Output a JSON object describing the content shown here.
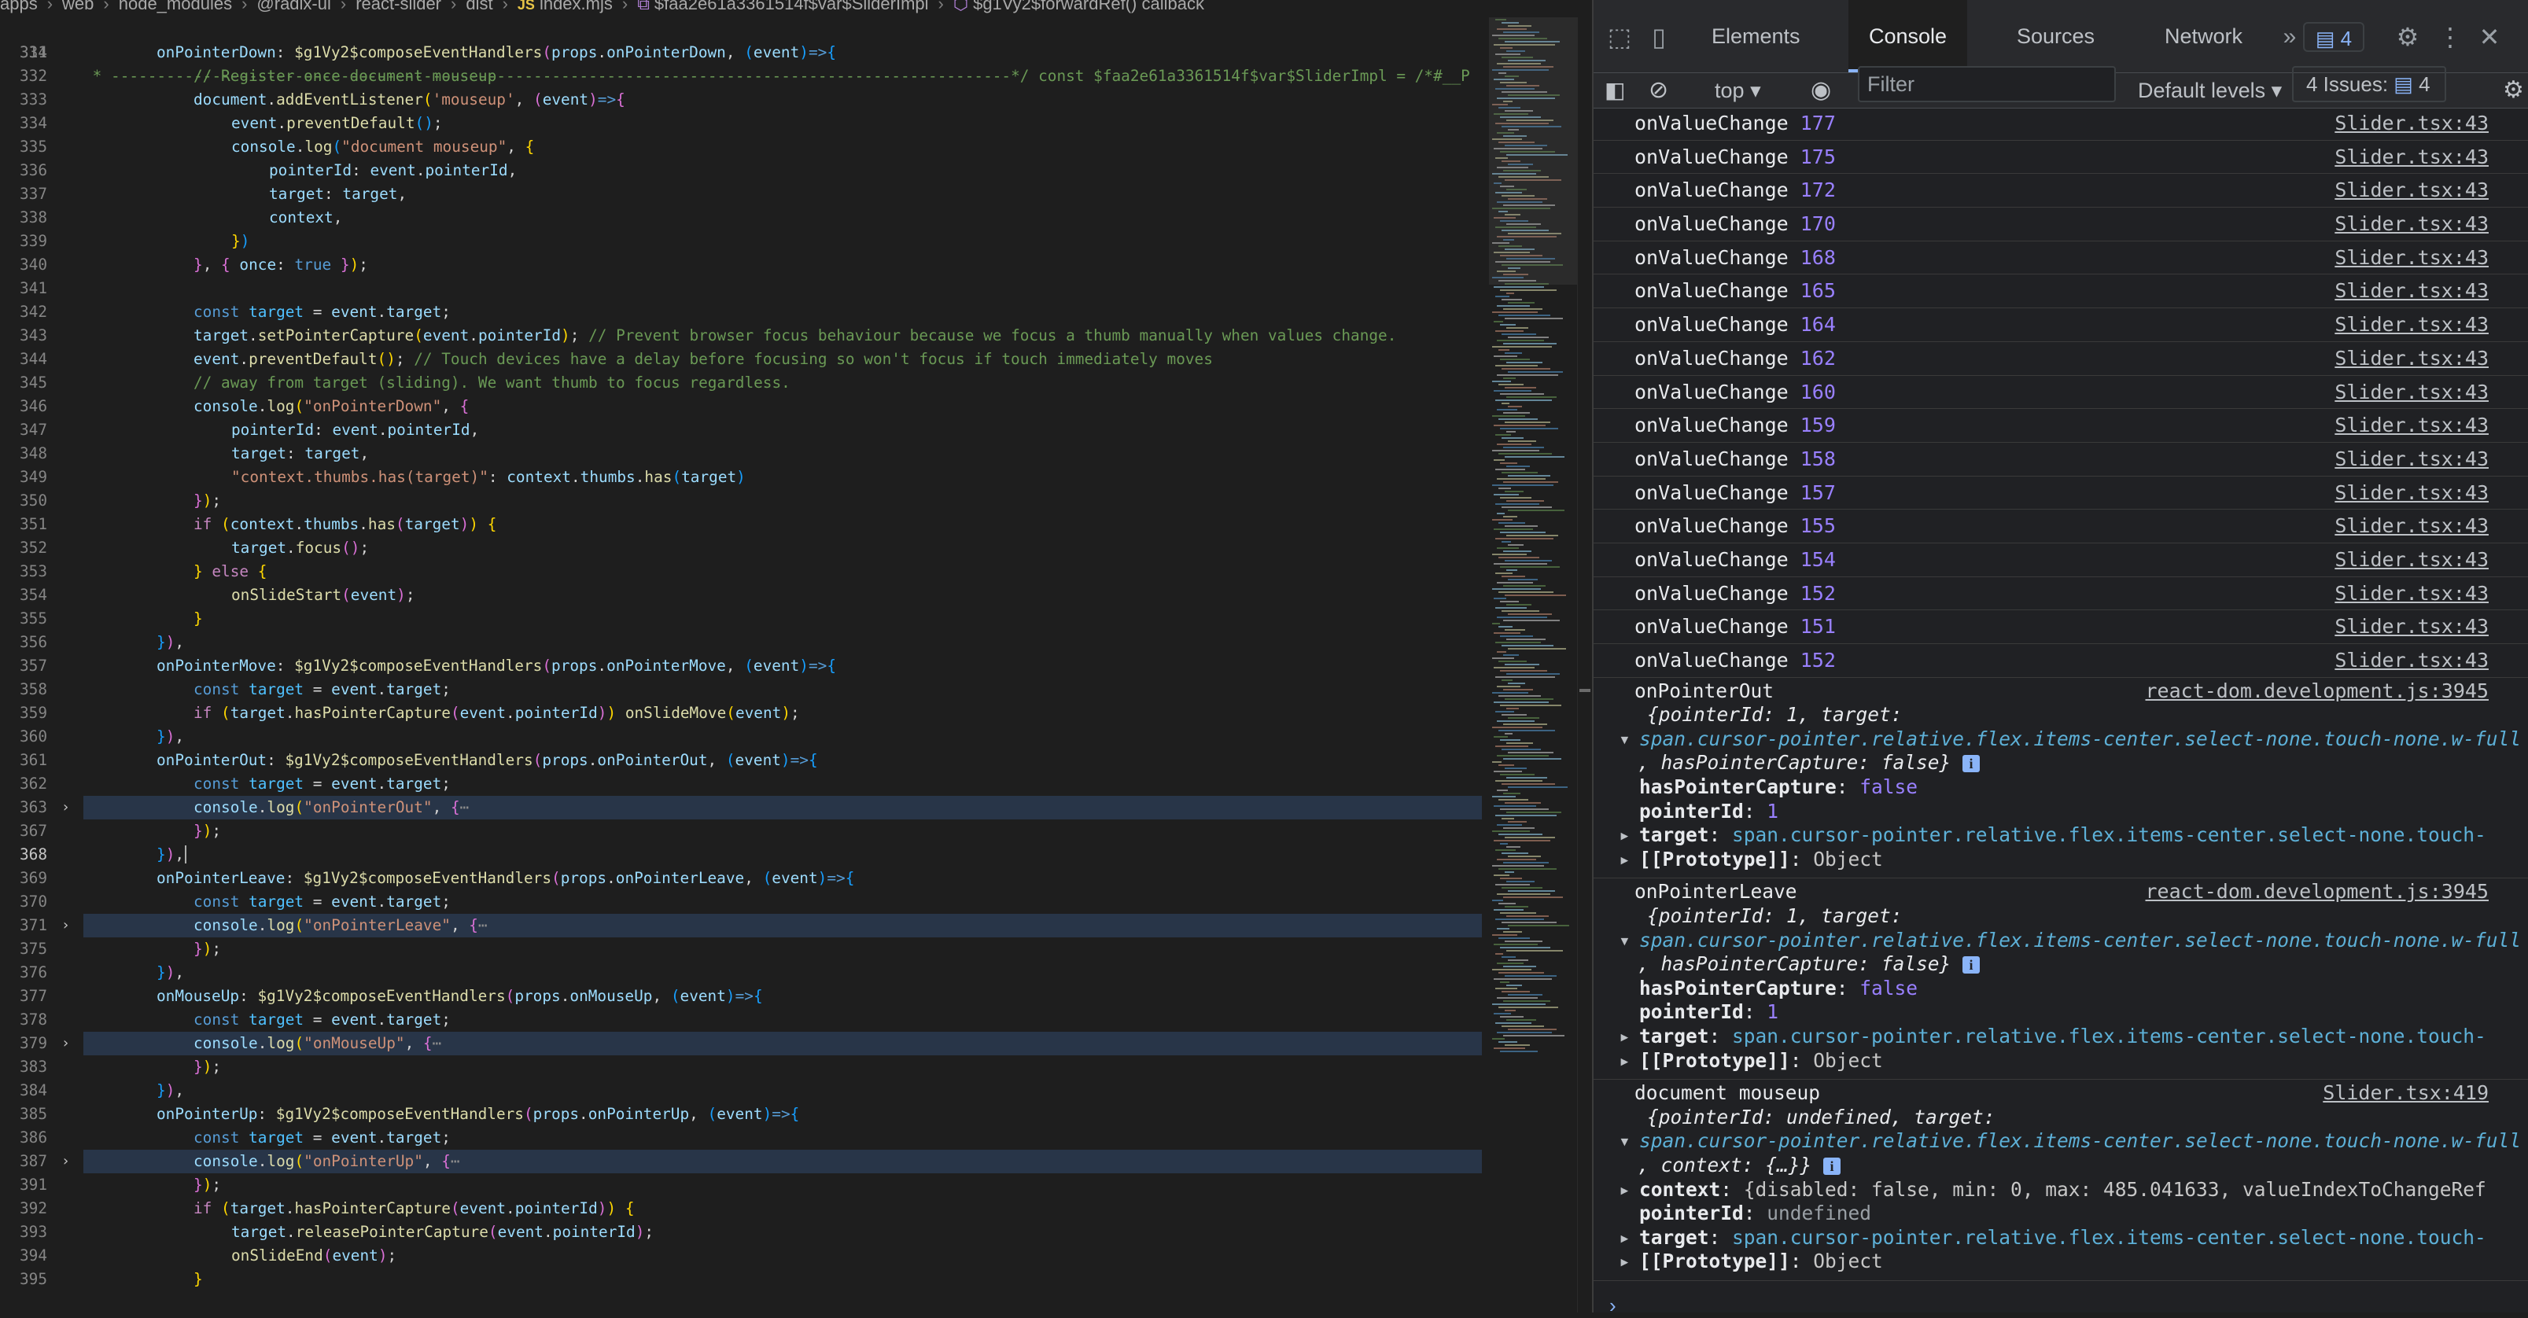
{
  "editor": {
    "breadcrumb": [
      "apps",
      "web",
      "node_modules",
      "@radix-ui",
      "react-slider",
      "dist",
      "index.mjs",
      "$faa2e61a3361514f$var$SliderImpl",
      "$g1Vy2$forwardRef() callback"
    ],
    "breadcrumb_js_icon": "JS",
    "sticky_line_number": "314",
    "sticky_line_text": " * --------------------------------------------------------------------------------------------------*/ const $faa2e61a3361514f$var$SliderImpl = /*#__P",
    "lines": [
      {
        "n": "331",
        "html": "<span class=\"i1\"></span><span class=\"v\">onPointerDown</span>: <span class=\"fn\">$g1Vy2$composeEventHandlers</span><span class=\"b2\">(</span><span class=\"v\">props</span>.<span class=\"v\">onPointerDown</span>, <span class=\"b3\">(</span><span class=\"v\">event</span><span class=\"b3\">)</span><span class=\"kw\">=></span><span class=\"b3\">{</span>"
      },
      {
        "n": "332",
        "html": "<span class=\"i2\"></span><span class=\"c\">// Register once document mouseup</span>"
      },
      {
        "n": "333",
        "html": "<span class=\"i2\"></span><span class=\"v\">document</span>.<span class=\"fn\">addEventListener</span><span class=\"b1\">(</span><span class=\"s\">'mouseup'</span>, <span class=\"b2\">(</span><span class=\"v\">event</span><span class=\"b2\">)</span><span class=\"kw\">=></span><span class=\"b2\">{</span>"
      },
      {
        "n": "334",
        "html": "<span class=\"i3\"></span><span class=\"v\">event</span>.<span class=\"fn\">preventDefault</span><span class=\"b3\">()</span>;"
      },
      {
        "n": "335",
        "html": "<span class=\"i3\"></span><span class=\"v\">console</span>.<span class=\"fn\">log</span><span class=\"b3\">(</span><span class=\"s\">\"document mouseup\"</span>, <span class=\"b1\">{</span>"
      },
      {
        "n": "336",
        "html": "<span class=\"i4\"></span><span class=\"v\">pointerId</span>: <span class=\"v\">event</span>.<span class=\"v\">pointerId</span>,"
      },
      {
        "n": "337",
        "html": "<span class=\"i4\"></span><span class=\"v\">target</span>: <span class=\"v\">target</span>,"
      },
      {
        "n": "338",
        "html": "<span class=\"i4\"></span><span class=\"v\">context</span>,"
      },
      {
        "n": "339",
        "html": "<span class=\"i3\"></span><span class=\"b1\">}</span><span class=\"b3\">)</span>"
      },
      {
        "n": "340",
        "html": "<span class=\"i2\"></span><span class=\"b2\">}</span>, <span class=\"b2\">{</span> <span class=\"v\">once</span>: <span class=\"kw\">true</span> <span class=\"b2\">}</span><span class=\"b1\">)</span>;"
      },
      {
        "n": "341",
        "html": ""
      },
      {
        "n": "342",
        "html": "<span class=\"i2\"></span><span class=\"kw\">const</span> <span class=\"n\">target</span> = <span class=\"v\">event</span>.<span class=\"v\">target</span>;"
      },
      {
        "n": "343",
        "html": "<span class=\"i2\"></span><span class=\"v\">target</span>.<span class=\"fn\">setPointerCapture</span><span class=\"b1\">(</span><span class=\"v\">event</span>.<span class=\"v\">pointerId</span><span class=\"b1\">)</span>; <span class=\"c\">// Prevent browser focus behaviour because we focus a thumb manually when values change.</span>"
      },
      {
        "n": "344",
        "html": "<span class=\"i2\"></span><span class=\"v\">event</span>.<span class=\"fn\">preventDefault</span><span class=\"b1\">()</span>; <span class=\"c\">// Touch devices have a delay before focusing so won't focus if touch immediately moves</span>"
      },
      {
        "n": "345",
        "html": "<span class=\"i2\"></span><span class=\"c\">// away from target (sliding). We want thumb to focus regardless.</span>"
      },
      {
        "n": "346",
        "html": "<span class=\"i2\"></span><span class=\"v\">console</span>.<span class=\"fn\">log</span><span class=\"b1\">(</span><span class=\"s\">\"onPointerDown\"</span>, <span class=\"b2\">{</span>"
      },
      {
        "n": "347",
        "html": "<span class=\"i3\"></span><span class=\"v\">pointerId</span>: <span class=\"v\">event</span>.<span class=\"v\">pointerId</span>,"
      },
      {
        "n": "348",
        "html": "<span class=\"i3\"></span><span class=\"v\">target</span>: <span class=\"v\">target</span>,"
      },
      {
        "n": "349",
        "html": "<span class=\"i3\"></span><span class=\"s\">\"context.thumbs.has(target)\"</span>: <span class=\"v\">context</span>.<span class=\"v\">thumbs</span>.<span class=\"fn\">has</span><span class=\"b3\">(</span><span class=\"v\">target</span><span class=\"b3\">)</span>"
      },
      {
        "n": "350",
        "html": "<span class=\"i2\"></span><span class=\"b2\">}</span><span class=\"b1\">)</span>;"
      },
      {
        "n": "351",
        "html": "<span class=\"i2\"></span><span class=\"kc\">if</span> <span class=\"b1\">(</span><span class=\"v\">context</span>.<span class=\"v\">thumbs</span>.<span class=\"fn\">has</span><span class=\"b2\">(</span><span class=\"v\">target</span><span class=\"b2\">)</span><span class=\"b1\">)</span> <span class=\"b1\">{</span>"
      },
      {
        "n": "352",
        "html": "<span class=\"i3\"></span><span class=\"v\">target</span>.<span class=\"fn\">focus</span><span class=\"b2\">()</span>;"
      },
      {
        "n": "353",
        "html": "<span class=\"i2\"></span><span class=\"b1\">}</span> <span class=\"kc\">else</span> <span class=\"b1\">{</span>"
      },
      {
        "n": "354",
        "html": "<span class=\"i3\"></span><span class=\"fn\">onSlideStart</span><span class=\"b2\">(</span><span class=\"v\">event</span><span class=\"b2\">)</span>;"
      },
      {
        "n": "355",
        "html": "<span class=\"i2\"></span><span class=\"b1\">}</span>"
      },
      {
        "n": "356",
        "html": "<span class=\"i1\"></span><span class=\"b3\">}</span><span class=\"b2\">)</span>,"
      },
      {
        "n": "357",
        "html": "<span class=\"i1\"></span><span class=\"v\">onPointerMove</span>: <span class=\"fn\">$g1Vy2$composeEventHandlers</span><span class=\"b2\">(</span><span class=\"v\">props</span>.<span class=\"v\">onPointerMove</span>, <span class=\"b3\">(</span><span class=\"v\">event</span><span class=\"b3\">)</span><span class=\"kw\">=></span><span class=\"b3\">{</span>"
      },
      {
        "n": "358",
        "html": "<span class=\"i2\"></span><span class=\"kw\">const</span> <span class=\"n\">target</span> = <span class=\"v\">event</span>.<span class=\"v\">target</span>;"
      },
      {
        "n": "359",
        "html": "<span class=\"i2\"></span><span class=\"kc\">if</span> <span class=\"b1\">(</span><span class=\"v\">target</span>.<span class=\"fn\">hasPointerCapture</span><span class=\"b2\">(</span><span class=\"v\">event</span>.<span class=\"v\">pointerId</span><span class=\"b2\">)</span><span class=\"b1\">)</span> <span class=\"fn\">onSlideMove</span><span class=\"b1\">(</span><span class=\"v\">event</span><span class=\"b1\">)</span>;"
      },
      {
        "n": "360",
        "html": "<span class=\"i1\"></span><span class=\"b3\">}</span><span class=\"b2\">)</span>,"
      },
      {
        "n": "361",
        "html": "<span class=\"i1\"></span><span class=\"v\">onPointerOut</span>: <span class=\"fn\">$g1Vy2$composeEventHandlers</span><span class=\"b2\">(</span><span class=\"v\">props</span>.<span class=\"v\">onPointerOut</span>, <span class=\"b3\">(</span><span class=\"v\">event</span><span class=\"b3\">)</span><span class=\"kw\">=></span><span class=\"b3\">{</span>"
      },
      {
        "n": "362",
        "html": "<span class=\"i2\"></span><span class=\"kw\">const</span> <span class=\"n\">target</span> = <span class=\"v\">event</span>.<span class=\"v\">target</span>;"
      },
      {
        "n": "363",
        "fold": true,
        "hl": true,
        "html": "<span class=\"i2\"></span><span class=\"v\">console</span>.<span class=\"fn\">log</span><span class=\"b1\">(</span><span class=\"s\">\"onPointerOut\"</span>, <span class=\"b2\">{</span><span class=\"ell\">⋯</span>"
      },
      {
        "n": "367",
        "html": "<span class=\"i2\"></span><span class=\"b2\">}</span><span class=\"b1\">)</span>;"
      },
      {
        "n": "368",
        "cur": true,
        "html": "<span class=\"i1\"></span><span class=\"b3\">}</span><span class=\"b2\">)</span>,<span style=\"border-left:2px solid #aeafad;margin-left:1px\"></span>"
      },
      {
        "n": "369",
        "html": "<span class=\"i1\"></span><span class=\"v\">onPointerLeave</span>: <span class=\"fn\">$g1Vy2$composeEventHandlers</span><span class=\"b2\">(</span><span class=\"v\">props</span>.<span class=\"v\">onPointerLeave</span>, <span class=\"b3\">(</span><span class=\"v\">event</span><span class=\"b3\">)</span><span class=\"kw\">=></span><span class=\"b3\">{</span>"
      },
      {
        "n": "370",
        "html": "<span class=\"i2\"></span><span class=\"kw\">const</span> <span class=\"n\">target</span> = <span class=\"v\">event</span>.<span class=\"v\">target</span>;"
      },
      {
        "n": "371",
        "fold": true,
        "hl": true,
        "html": "<span class=\"i2\"></span><span class=\"v\">console</span>.<span class=\"fn\">log</span><span class=\"b1\">(</span><span class=\"s\">\"onPointerLeave\"</span>, <span class=\"b2\">{</span><span class=\"ell\">⋯</span>"
      },
      {
        "n": "375",
        "html": "<span class=\"i2\"></span><span class=\"b2\">}</span><span class=\"b1\">)</span>;"
      },
      {
        "n": "376",
        "html": "<span class=\"i1\"></span><span class=\"b3\">}</span><span class=\"b2\">)</span>,"
      },
      {
        "n": "377",
        "html": "<span class=\"i1\"></span><span class=\"v\">onMouseUp</span>: <span class=\"fn\">$g1Vy2$composeEventHandlers</span><span class=\"b2\">(</span><span class=\"v\">props</span>.<span class=\"v\">onMouseUp</span>, <span class=\"b3\">(</span><span class=\"v\">event</span><span class=\"b3\">)</span><span class=\"kw\">=></span><span class=\"b3\">{</span>"
      },
      {
        "n": "378",
        "html": "<span class=\"i2\"></span><span class=\"kw\">const</span> <span class=\"n\">target</span> = <span class=\"v\">event</span>.<span class=\"v\">target</span>;"
      },
      {
        "n": "379",
        "fold": true,
        "hl": true,
        "html": "<span class=\"i2\"></span><span class=\"v\">console</span>.<span class=\"fn\">log</span><span class=\"b1\">(</span><span class=\"s\">\"onMouseUp\"</span>, <span class=\"b2\">{</span><span class=\"ell\">⋯</span>"
      },
      {
        "n": "383",
        "html": "<span class=\"i2\"></span><span class=\"b2\">}</span><span class=\"b1\">)</span>;"
      },
      {
        "n": "384",
        "html": "<span class=\"i1\"></span><span class=\"b3\">}</span><span class=\"b2\">)</span>,"
      },
      {
        "n": "385",
        "html": "<span class=\"i1\"></span><span class=\"v\">onPointerUp</span>: <span class=\"fn\">$g1Vy2$composeEventHandlers</span><span class=\"b2\">(</span><span class=\"v\">props</span>.<span class=\"v\">onPointerUp</span>, <span class=\"b3\">(</span><span class=\"v\">event</span><span class=\"b3\">)</span><span class=\"kw\">=></span><span class=\"b3\">{</span>"
      },
      {
        "n": "386",
        "html": "<span class=\"i2\"></span><span class=\"kw\">const</span> <span class=\"n\">target</span> = <span class=\"v\">event</span>.<span class=\"v\">target</span>;"
      },
      {
        "n": "387",
        "fold": true,
        "hl": true,
        "html": "<span class=\"i2\"></span><span class=\"v\">console</span>.<span class=\"fn\">log</span><span class=\"b1\">(</span><span class=\"s\">\"onPointerUp\"</span>, <span class=\"b2\">{</span><span class=\"ell\">⋯</span>"
      },
      {
        "n": "391",
        "html": "<span class=\"i2\"></span><span class=\"b2\">}</span><span class=\"b1\">)</span>;"
      },
      {
        "n": "392",
        "html": "<span class=\"i2\"></span><span class=\"kc\">if</span> <span class=\"b1\">(</span><span class=\"v\">target</span>.<span class=\"fn\">hasPointerCapture</span><span class=\"b2\">(</span><span class=\"v\">event</span>.<span class=\"v\">pointerId</span><span class=\"b2\">)</span><span class=\"b1\">)</span> <span class=\"b1\">{</span>"
      },
      {
        "n": "393",
        "html": "<span class=\"i3\"></span><span class=\"v\">target</span>.<span class=\"fn\">releasePointerCapture</span><span class=\"b2\">(</span><span class=\"v\">event</span>.<span class=\"v\">pointerId</span><span class=\"b2\">)</span>;"
      },
      {
        "n": "394",
        "html": "<span class=\"i3\"></span><span class=\"fn\">onSlideEnd</span><span class=\"b2\">(</span><span class=\"v\">event</span><span class=\"b2\">)</span>;"
      },
      {
        "n": "395",
        "html": "<span class=\"i2\"></span><span class=\"b1\">}</span>"
      }
    ]
  },
  "devtools": {
    "tabs": [
      "Elements",
      "Console",
      "Sources",
      "Network"
    ],
    "active_tab": "Console",
    "more_tabs_icon": "chevron-double-right-icon",
    "message_count": "4",
    "toolbar": {
      "context": "top",
      "filter_placeholder": "Filter",
      "levels": "Default levels",
      "issues_label": "4 Issues:",
      "issues_count": "4"
    },
    "value_changes": [
      {
        "label": "onValueChange",
        "value": "177",
        "src": "Slider.tsx:43"
      },
      {
        "label": "onValueChange",
        "value": "175",
        "src": "Slider.tsx:43"
      },
      {
        "label": "onValueChange",
        "value": "172",
        "src": "Slider.tsx:43"
      },
      {
        "label": "onValueChange",
        "value": "170",
        "src": "Slider.tsx:43"
      },
      {
        "label": "onValueChange",
        "value": "168",
        "src": "Slider.tsx:43"
      },
      {
        "label": "onValueChange",
        "value": "165",
        "src": "Slider.tsx:43"
      },
      {
        "label": "onValueChange",
        "value": "164",
        "src": "Slider.tsx:43"
      },
      {
        "label": "onValueChange",
        "value": "162",
        "src": "Slider.tsx:43"
      },
      {
        "label": "onValueChange",
        "value": "160",
        "src": "Slider.tsx:43"
      },
      {
        "label": "onValueChange",
        "value": "159",
        "src": "Slider.tsx:43"
      },
      {
        "label": "onValueChange",
        "value": "158",
        "src": "Slider.tsx:43"
      },
      {
        "label": "onValueChange",
        "value": "157",
        "src": "Slider.tsx:43"
      },
      {
        "label": "onValueChange",
        "value": "155",
        "src": "Slider.tsx:43"
      },
      {
        "label": "onValueChange",
        "value": "154",
        "src": "Slider.tsx:43"
      },
      {
        "label": "onValueChange",
        "value": "152",
        "src": "Slider.tsx:43"
      },
      {
        "label": "onValueChange",
        "value": "151",
        "src": "Slider.tsx:43"
      },
      {
        "label": "onValueChange",
        "value": "152",
        "src": "Slider.tsx:43"
      }
    ],
    "groups": [
      {
        "title": "onPointerOut",
        "src": "react-dom.development.js:3945",
        "summary": "{pointerId: 1, target:",
        "elem": "span.cursor-pointer.relative.flex.items-center.select-none.touch-none.w-full",
        "tail": ", hasPointerCapture: false}",
        "props": [
          {
            "k": "hasPointerCapture",
            "v": "false",
            "t": "bool"
          },
          {
            "k": "pointerId",
            "v": "1",
            "t": "num"
          },
          {
            "k": "target",
            "v": "span.cursor-pointer.relative.flex.items-center.select-none.touch-",
            "t": "elem",
            "exp": true
          },
          {
            "k": "[[Prototype]]",
            "v": "Object",
            "t": "plain",
            "exp": true
          }
        ]
      },
      {
        "title": "onPointerLeave",
        "src": "react-dom.development.js:3945",
        "summary": "{pointerId: 1, target:",
        "elem": "span.cursor-pointer.relative.flex.items-center.select-none.touch-none.w-full",
        "tail": ", hasPointerCapture: false}",
        "props": [
          {
            "k": "hasPointerCapture",
            "v": "false",
            "t": "bool"
          },
          {
            "k": "pointerId",
            "v": "1",
            "t": "num"
          },
          {
            "k": "target",
            "v": "span.cursor-pointer.relative.flex.items-center.select-none.touch-",
            "t": "elem",
            "exp": true
          },
          {
            "k": "[[Prototype]]",
            "v": "Object",
            "t": "plain",
            "exp": true
          }
        ]
      },
      {
        "title": "document mouseup",
        "src": "Slider.tsx:419",
        "summary": "{pointerId: undefined, target:",
        "elem": "span.cursor-pointer.relative.flex.items-center.select-none.touch-none.w-full",
        "tail": ", context: {…}}",
        "props": [
          {
            "k": "context",
            "v": "{disabled: false, min: 0, max: 485.041633, valueIndexToChangeRef",
            "t": "plain",
            "exp": true
          },
          {
            "k": "pointerId",
            "v": "undefined",
            "t": "undef"
          },
          {
            "k": "target",
            "v": "span.cursor-pointer.relative.flex.items-center.select-none.touch-",
            "t": "elem",
            "exp": true
          },
          {
            "k": "[[Prototype]]",
            "v": "Object",
            "t": "plain",
            "exp": true
          }
        ]
      }
    ],
    "prompt_symbol": "›"
  }
}
